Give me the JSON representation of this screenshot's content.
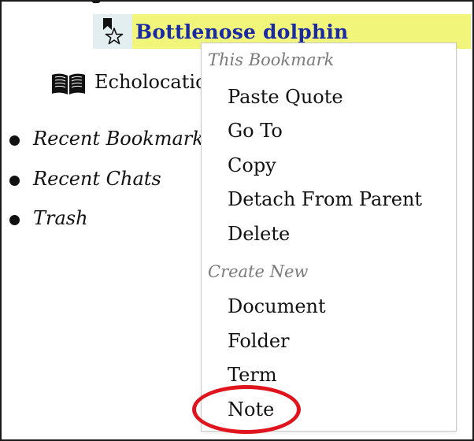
{
  "tree": {
    "selected_item": {
      "label": "Bottlenose dolphin",
      "icon": "bookmark-star-icon",
      "highlight_color": "#f1f57a",
      "text_color": "#1a2aa6"
    },
    "child_item": {
      "label": "Echolocation",
      "icon": "book-icon"
    },
    "nav_items": [
      {
        "label": "Recent Bookmarks",
        "icon": "bullet-icon"
      },
      {
        "label": "Recent Chats",
        "icon": "bullet-icon"
      },
      {
        "label": "Trash",
        "icon": "bullet-icon"
      }
    ]
  },
  "context_menu": {
    "section_this_bookmark": "This Bookmark",
    "this_bookmark_items": [
      "Paste Quote",
      "Go To",
      "Copy",
      "Detach From Parent",
      "Delete"
    ],
    "section_create_new": "Create New",
    "create_new_items": [
      "Document",
      "Folder",
      "Term",
      "Note"
    ],
    "highlighted_item": "Note",
    "highlight_color": "#e0141c"
  }
}
